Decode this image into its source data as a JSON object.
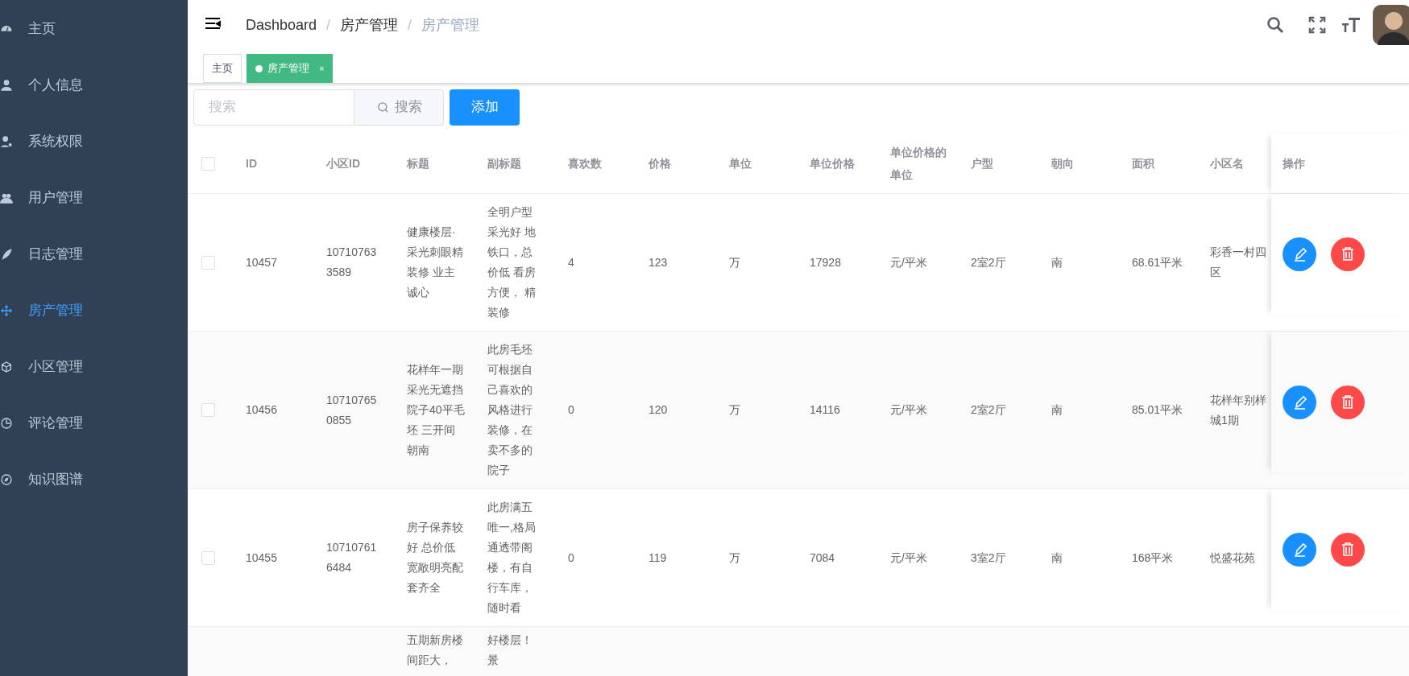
{
  "sidebar": {
    "items": [
      {
        "label": "主页",
        "selected": false
      },
      {
        "label": "个人信息",
        "selected": false
      },
      {
        "label": "系统权限",
        "selected": false
      },
      {
        "label": "用户管理",
        "selected": false
      },
      {
        "label": "日志管理",
        "selected": false
      },
      {
        "label": "房产管理",
        "selected": true
      },
      {
        "label": "小区管理",
        "selected": false
      },
      {
        "label": "评论管理",
        "selected": false
      },
      {
        "label": "知识图谱",
        "selected": false
      }
    ]
  },
  "breadcrumb": [
    {
      "label": "Dashboard"
    },
    {
      "separator": "/",
      "label": "房产管理"
    },
    {
      "separator": "/",
      "label": "房产管理"
    }
  ],
  "tabs": [
    {
      "label": "主页",
      "selected": false
    },
    {
      "label": "房产管理",
      "selected": true,
      "close": "×"
    }
  ],
  "search": {
    "placeholder": "搜索",
    "button": "搜索"
  },
  "add_button": "添加",
  "table": {
    "header_checked": false,
    "columns": [
      "ID",
      "小区ID",
      "标题",
      "副标题",
      "喜欢数",
      "价格",
      "单位",
      "单位价格",
      "单位价格的单位",
      "户型",
      "朝向",
      "面积",
      "小区名",
      "操作"
    ],
    "rows": [
      {
        "checked": false,
        "cells": [
          "10457",
          "107107633589",
          "健康楼层·采光刺眼精装修 业主诚心",
          "全明户型采光好 地铁口，总价低 看房方便， 精装修",
          "4",
          "123",
          "万",
          "17928",
          "元/平米",
          "2室2厅",
          "南",
          "68.61平米",
          "彩香一村四区"
        ]
      },
      {
        "checked": false,
        "cells": [
          "10456",
          "107107650855",
          "花样年一期采光无遮挡院子40平毛坯 三开间朝南",
          "此房毛坯可根据自己喜欢的风格进行装修，在卖不多的院子",
          "0",
          "120",
          "万",
          "14116",
          "元/平米",
          "2室2厅",
          "南",
          "85.01平米",
          "花样年别样城1期"
        ]
      },
      {
        "checked": false,
        "cells": [
          "10455",
          "107107616484",
          "房子保养较好 总价低宽敞明亮配套齐全",
          "此房满五唯一,格局通透带阁楼，有自行车库，随时看",
          "0",
          "119",
          "万",
          "7084",
          "元/平米",
          "3室2厅",
          "南",
          "168平米",
          "悦盛花苑"
        ]
      },
      {
        "cells": [
          null,
          null,
          "五期新房楼间距大，",
          "好楼层！景",
          null,
          null,
          null,
          null,
          null,
          null,
          null,
          null,
          null
        ]
      }
    ]
  }
}
